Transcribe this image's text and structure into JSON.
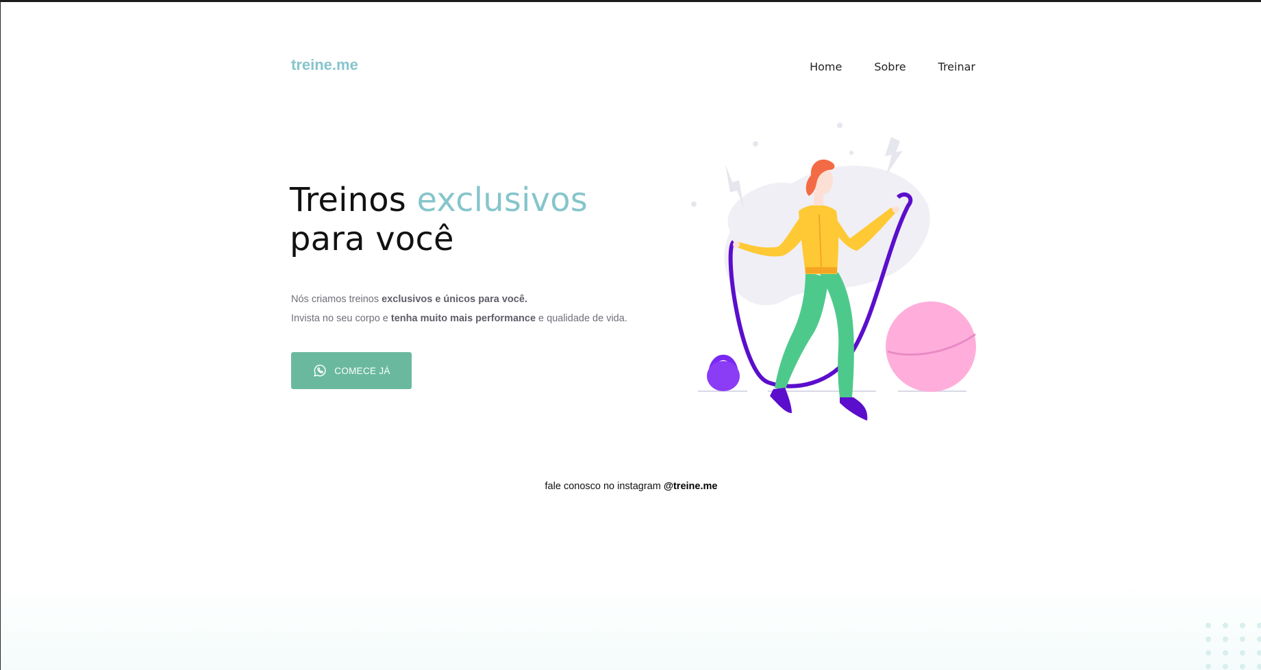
{
  "header": {
    "logo": "treine.me",
    "nav": [
      {
        "label": "Home"
      },
      {
        "label": "Sobre"
      },
      {
        "label": "Treinar"
      }
    ]
  },
  "hero": {
    "title_part1": "Treinos ",
    "title_accent": "exclusivos",
    "title_line2": "para você",
    "line1_pre": "Nós criamos treinos ",
    "line1_bold": "exclusivos e únicos para você.",
    "line2_pre": "Invista no seu corpo e ",
    "line2_bold": "tenha muito mais performance",
    "line2_post": " e qualidade de vida.",
    "cta_label": "COMECE JÁ",
    "cta_icon": "whatsapp-icon"
  },
  "footer": {
    "text": "fale conosco no instagram ",
    "handle": "@treine.me"
  },
  "colors": {
    "accent": "#86c5cc",
    "button": "#6ab99f",
    "text_muted": "#6f6f7a"
  },
  "illustration": {
    "name": "woman-jumping-rope"
  }
}
